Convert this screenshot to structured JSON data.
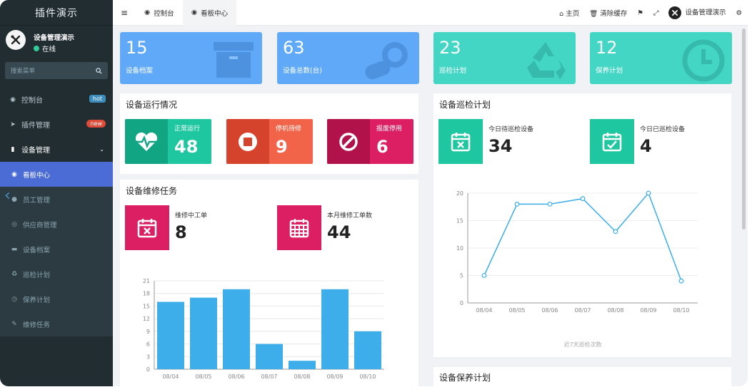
{
  "app": {
    "title": "插件演示"
  },
  "user": {
    "name": "设备管理演示",
    "status": "在线"
  },
  "search": {
    "placeholder": "搜索菜单"
  },
  "menu": {
    "items": [
      {
        "label": "控制台",
        "badge": "hot",
        "icon": "dashboard-icon"
      },
      {
        "label": "插件管理",
        "badge": "new",
        "icon": "rocket-icon"
      },
      {
        "label": "设备管理",
        "icon": "mobile-icon",
        "expanded": true
      }
    ],
    "sub": [
      {
        "label": "看板中心",
        "icon": "dashboard-icon",
        "active": true
      },
      {
        "label": "员工管理",
        "icon": "user-icon"
      },
      {
        "label": "供应商管理",
        "icon": "eye-icon"
      },
      {
        "label": "设备档案",
        "icon": "archive-icon"
      },
      {
        "label": "巡检计划",
        "icon": "recycle-icon"
      },
      {
        "label": "保养计划",
        "icon": "clock-icon"
      },
      {
        "label": "维修任务",
        "icon": "wrench-icon"
      }
    ]
  },
  "topbar": {
    "tabs": [
      {
        "label": "控制台"
      },
      {
        "label": "看板中心"
      }
    ],
    "home": "主页",
    "clear_cache": "清除缓存",
    "user": "设备管理演示"
  },
  "stats": [
    {
      "value": "15",
      "label": "设备档案"
    },
    {
      "value": "63",
      "label": "设备总数(台)"
    },
    {
      "value": "23",
      "label": "巡检计划"
    },
    {
      "value": "12",
      "label": "保养计划"
    }
  ],
  "status_panel": {
    "title": "设备运行情况",
    "cards": [
      {
        "label": "正常运行",
        "value": "48"
      },
      {
        "label": "停机待修",
        "value": "9"
      },
      {
        "label": "报废停用",
        "value": "6"
      }
    ]
  },
  "repair_panel": {
    "title": "设备维修任务",
    "kpis": [
      {
        "label": "维修中工单",
        "value": "8"
      },
      {
        "label": "本月维修工单数",
        "value": "44"
      }
    ]
  },
  "inspection_panel": {
    "title": "设备巡检计划",
    "kpis": [
      {
        "label": "今日待巡检设备",
        "value": "34"
      },
      {
        "label": "今日已巡检设备",
        "value": "4"
      }
    ]
  },
  "maintenance_panel": {
    "title": "设备保养计划"
  },
  "chart_data": [
    {
      "type": "bar",
      "categories": [
        "08/04",
        "08/05",
        "08/06",
        "08/07",
        "08/08",
        "08/09",
        "08/10"
      ],
      "values": [
        16,
        17,
        19,
        6,
        2,
        19,
        9
      ],
      "yticks": [
        0,
        3,
        6,
        9,
        12,
        15,
        18,
        21
      ],
      "ylim": [
        0,
        21
      ],
      "color": "#3daee9"
    },
    {
      "type": "line",
      "categories": [
        "08/04",
        "08/05",
        "08/06",
        "08/07",
        "08/08",
        "08/09",
        "08/10"
      ],
      "values": [
        5,
        18,
        18,
        19,
        13,
        20,
        4
      ],
      "yticks": [
        0,
        5,
        10,
        15,
        20
      ],
      "ylim": [
        0,
        20
      ],
      "xlabel": "近7天巡检次数",
      "color": "#3daee9"
    }
  ]
}
